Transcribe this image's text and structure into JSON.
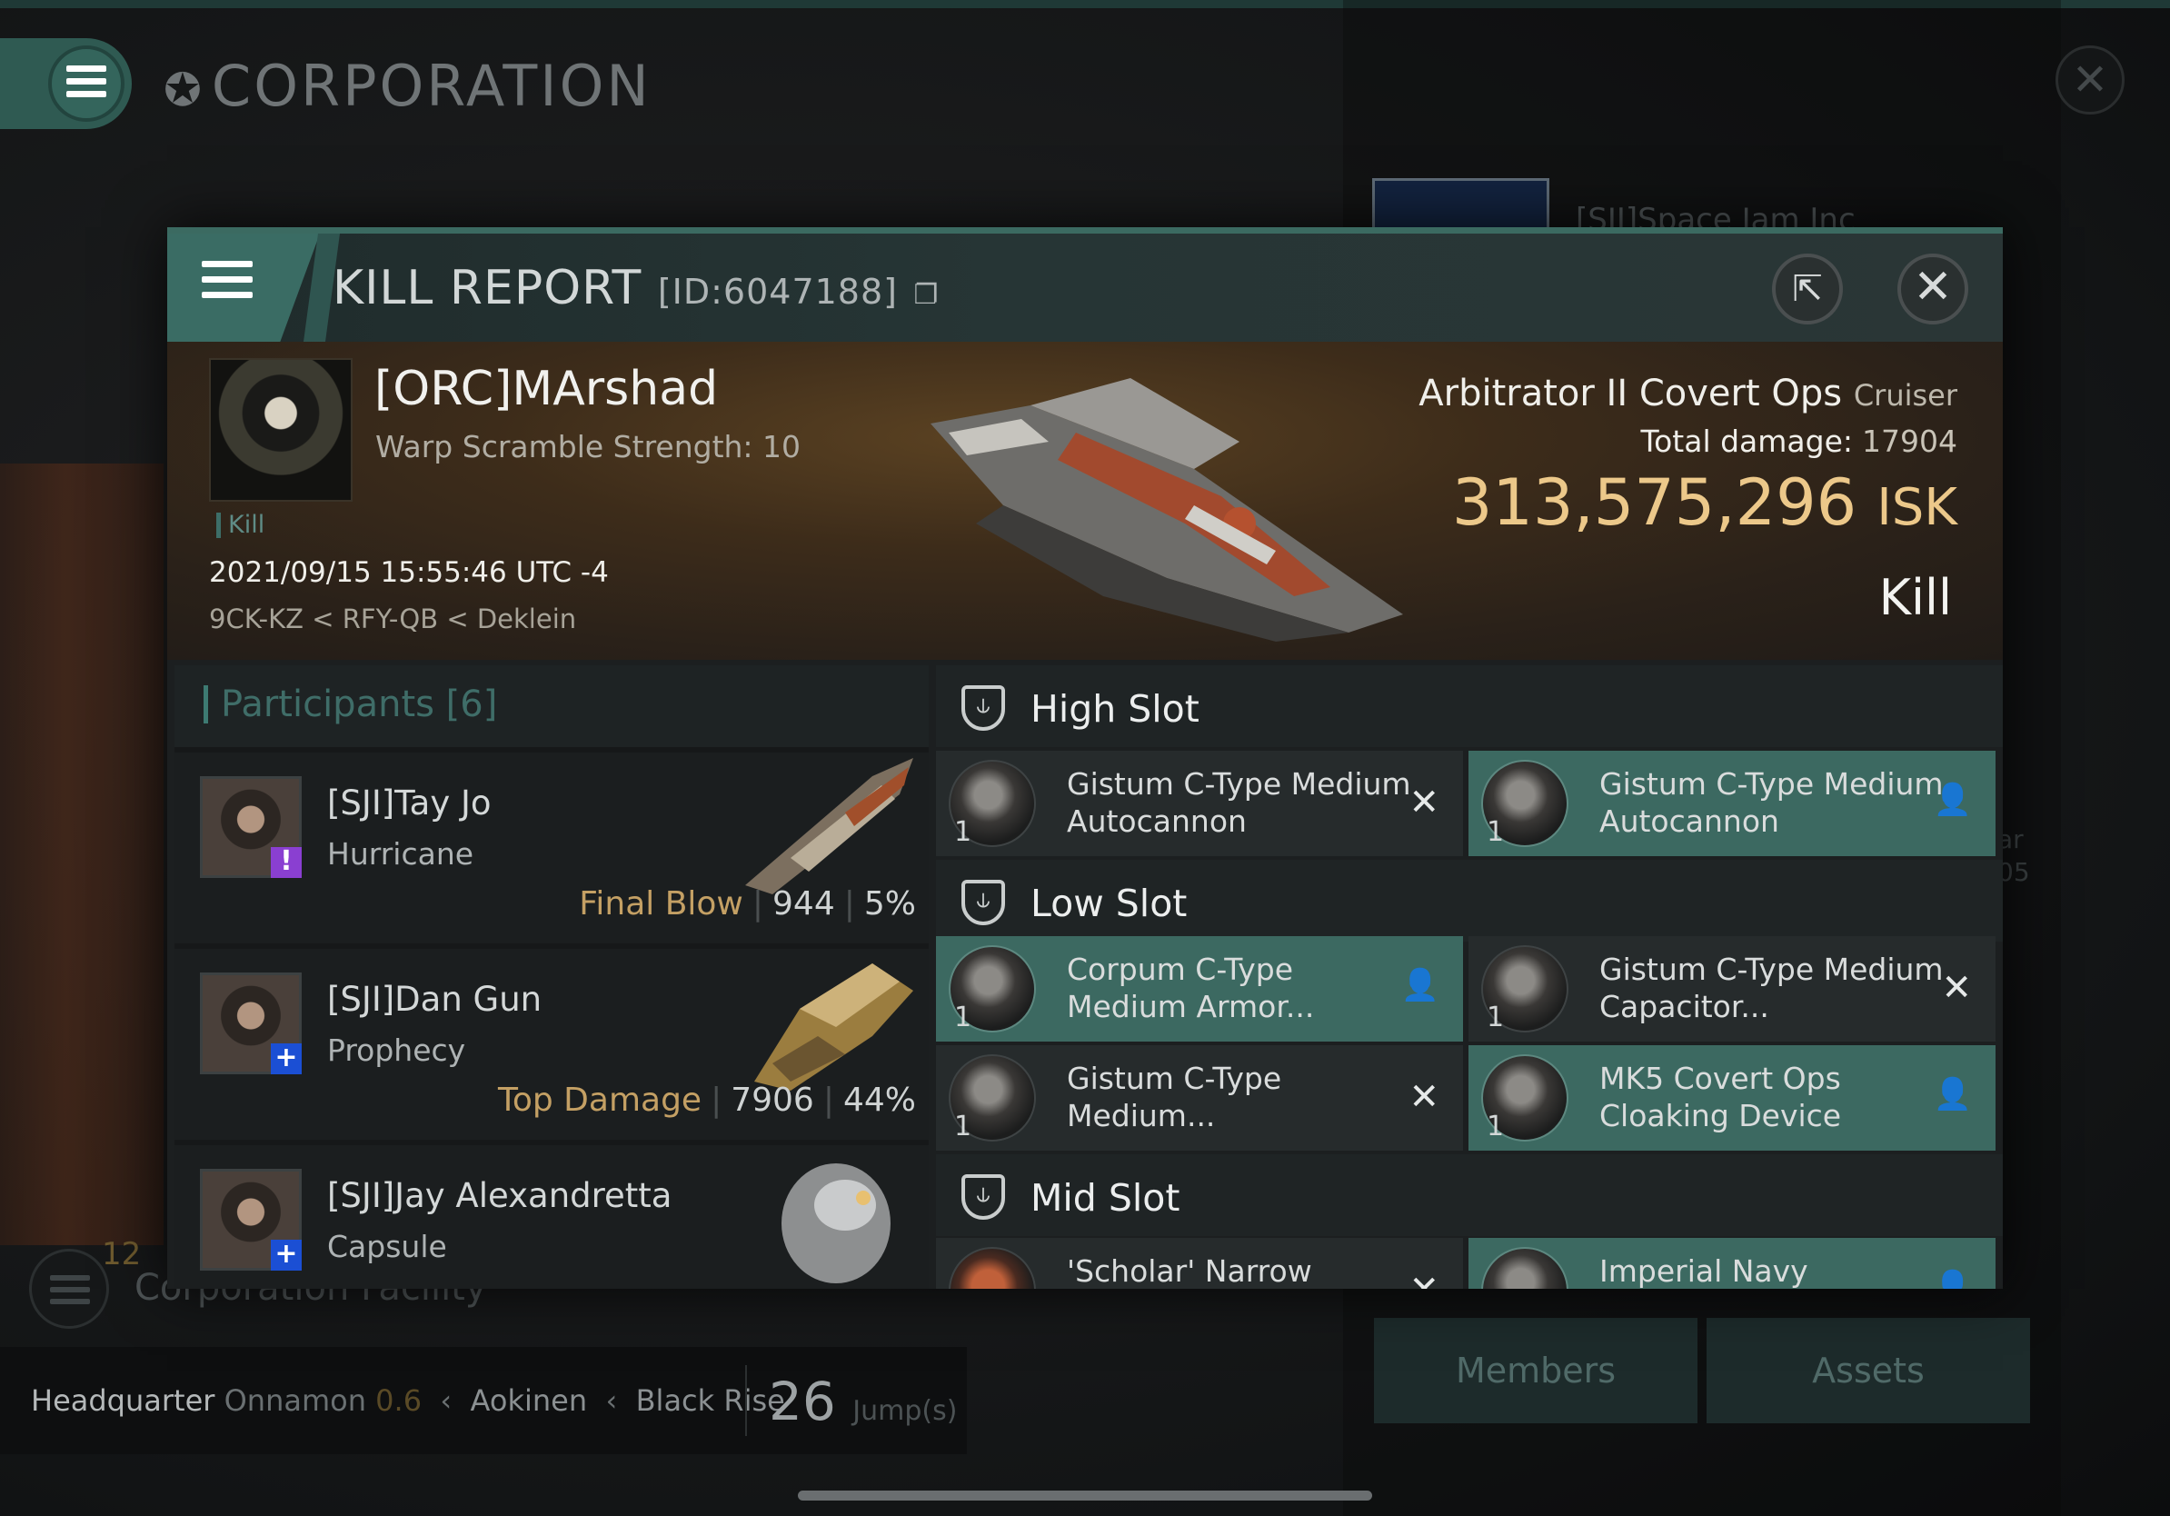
{
  "background": {
    "title": "CORPORATION",
    "corp_name": "[SJI]Space Jam Inc",
    "side_text": [
      "ar",
      "05"
    ],
    "facility_count": "12",
    "facility_label": "Corporation Facility",
    "hq": {
      "label": "Headquarter",
      "system": "Onnamon",
      "security": "0.6",
      "constellation": "Aokinen",
      "region": "Black Rise",
      "jumps": "26",
      "jumps_unit": "Jump(s)"
    },
    "buttons": {
      "members": "Members",
      "assets": "Assets"
    }
  },
  "window": {
    "title": "KILL REPORT",
    "report_id": "[ID:6047188]",
    "icons": {
      "menu": "menu-icon",
      "copy": "copy-icon",
      "export": "export-icon",
      "close": "close-icon"
    }
  },
  "victim": {
    "name": "[ORC]MArshad",
    "stat": "Warp Scramble Strength: 10",
    "tag": "Kill",
    "datetime": "2021/09/15 15:55:46 UTC -4",
    "location": "9CK-KZ < RFY-QB < Deklein",
    "ship": "Arbitrator II Covert Ops",
    "ship_class": "Cruiser",
    "total_damage_label": "Total damage:",
    "total_damage": "17904",
    "isk_value": "313,575,296",
    "isk_unit": "ISK",
    "result": "Kill"
  },
  "participants": {
    "label": "Participants [6]",
    "rows": [
      {
        "name": "[SJI]Tay Jo",
        "ship": "Hurricane",
        "role": "Final Blow",
        "damage": "944",
        "percent": "5%",
        "badge": "!",
        "badge_color": "#8a3fd1"
      },
      {
        "name": "[SJI]Dan Gun",
        "ship": "Prophecy",
        "role": "Top Damage",
        "damage": "7906",
        "percent": "44%",
        "badge": "+",
        "badge_color": "#1b4fd4"
      },
      {
        "name": "[SJI]Jay Alexandretta",
        "ship": "Capsule",
        "role": "",
        "damage": "",
        "percent": "",
        "badge": "+",
        "badge_color": "#1b4fd4"
      }
    ]
  },
  "fitting": {
    "high_slot": "High Slot",
    "low_slot": "Low Slot",
    "mid_slot": "Mid Slot",
    "high": [
      {
        "qty": "1",
        "name": "Gistum C-Type Medium Autocannon",
        "status": "destroyed"
      },
      {
        "qty": "1",
        "name": "Gistum C-Type Medium Autocannon",
        "status": "dropped"
      }
    ],
    "low": [
      {
        "qty": "1",
        "name": "Corpum C-Type Medium Armor...",
        "status": "dropped"
      },
      {
        "qty": "1",
        "name": "Gistum C-Type Medium Capacitor...",
        "status": "destroyed"
      },
      {
        "qty": "1",
        "name": "Gistum C-Type Medium...",
        "status": "destroyed"
      },
      {
        "qty": "1",
        "name": "MK5 Covert Ops Cloaking Device",
        "status": "dropped"
      }
    ],
    "mid": [
      {
        "qty": "",
        "name": "'Scholar' Narrow",
        "status": "destroyed"
      },
      {
        "qty": "",
        "name": "Imperial Navy",
        "status": "dropped"
      }
    ]
  },
  "colors": {
    "accent": "#3c6961",
    "isk": "#ecc88a",
    "role": "#c4a064"
  }
}
